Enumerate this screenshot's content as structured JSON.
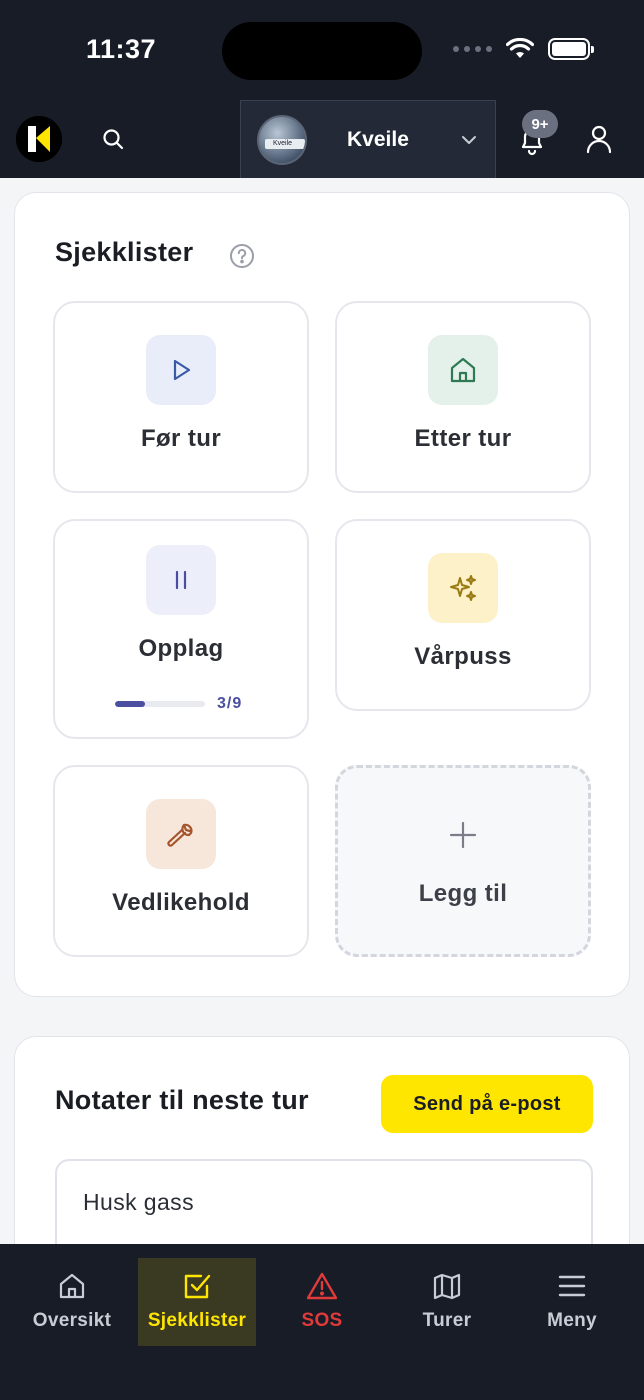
{
  "status_bar": {
    "time": "11:37"
  },
  "header": {
    "boat_name": "Kveile",
    "boat_image_text": "Kveile",
    "notification_count": "9+"
  },
  "checklists": {
    "title": "Sjekklister",
    "tiles": [
      {
        "label": "Før tur",
        "icon": "play-icon",
        "color": "#e8edf9"
      },
      {
        "label": "Etter tur",
        "icon": "home-icon",
        "color": "#e3f1ea"
      },
      {
        "label": "Opplag",
        "icon": "pause-icon",
        "color": "#eceef9",
        "progress_text": "3/9",
        "progress": 0.333
      },
      {
        "label": "Vårpuss",
        "icon": "sparkles-icon",
        "color": "#fdf1c9"
      },
      {
        "label": "Vedlikehold",
        "icon": "wrench-icon",
        "color": "#f7e6da"
      },
      {
        "label": "Legg til",
        "icon": "plus-icon"
      }
    ]
  },
  "notes": {
    "title": "Notater til neste tur",
    "send_label": "Send på e-post",
    "text": "Husk gass"
  },
  "bottom_nav": [
    {
      "label": "Oversikt",
      "icon": "home-icon"
    },
    {
      "label": "Sjekklister",
      "icon": "checkbox-icon",
      "active": true
    },
    {
      "label": "SOS",
      "icon": "warning-icon"
    },
    {
      "label": "Turer",
      "icon": "map-icon"
    },
    {
      "label": "Meny",
      "icon": "menu-icon"
    }
  ],
  "colors": {
    "brand_yellow": "#ffe600",
    "header_bg": "#171c27",
    "progress": "#4b4fa0",
    "sos_red": "#e03a3a"
  }
}
